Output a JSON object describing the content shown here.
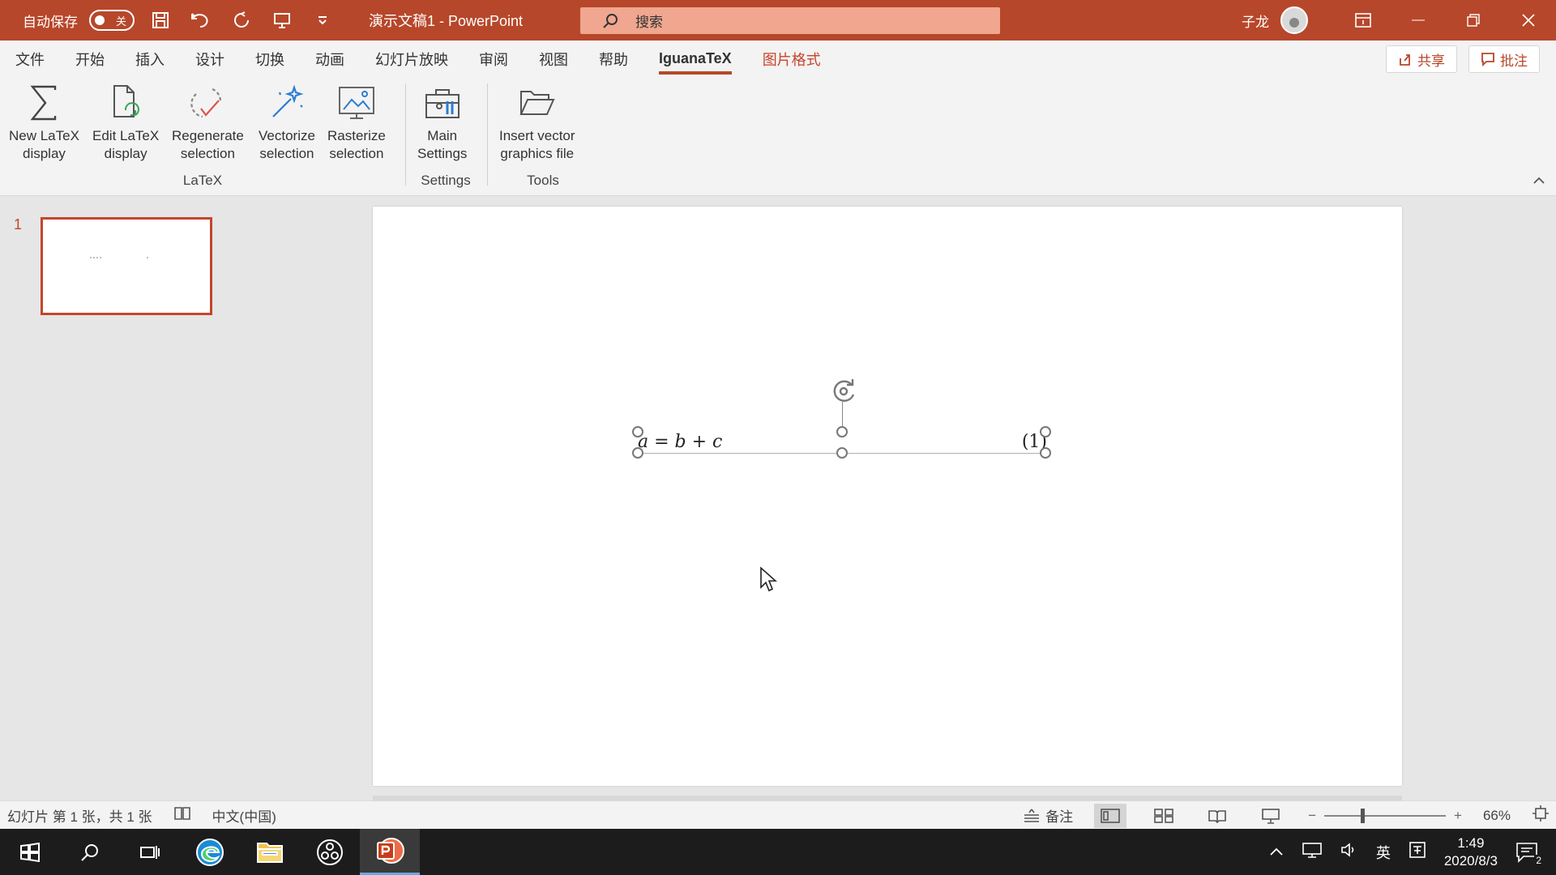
{
  "window": {
    "autosave_label": "自动保存",
    "autosave_state": "关",
    "doc_title": "演示文稿1 - PowerPoint",
    "search_placeholder": "搜索",
    "user_name": "子龙",
    "accent_color": "#b7472a"
  },
  "tabs": [
    {
      "label": "文件"
    },
    {
      "label": "开始"
    },
    {
      "label": "插入"
    },
    {
      "label": "设计"
    },
    {
      "label": "切换"
    },
    {
      "label": "动画"
    },
    {
      "label": "幻灯片放映"
    },
    {
      "label": "审阅"
    },
    {
      "label": "视图"
    },
    {
      "label": "帮助"
    },
    {
      "label": "IguanaTeX",
      "active": true
    },
    {
      "label": "图片格式",
      "contextual": true
    }
  ],
  "tab_actions": {
    "share": "共享",
    "comments": "批注"
  },
  "ribbon": {
    "groups": [
      {
        "label": "LaTeX",
        "buttons": [
          {
            "line1": "New LaTeX",
            "line2": "display",
            "icon": "sigma-icon"
          },
          {
            "line1": "Edit LaTeX",
            "line2": "display",
            "icon": "edit-document-icon"
          },
          {
            "line1": "Regenerate",
            "line2": "selection",
            "icon": "regenerate-icon"
          },
          {
            "line1": "Vectorize",
            "line2": "selection",
            "icon": "magic-wand-icon"
          },
          {
            "line1": "Rasterize",
            "line2": "selection",
            "icon": "rasterize-icon"
          }
        ]
      },
      {
        "label": "Settings",
        "buttons": [
          {
            "line1": "Main",
            "line2": "Settings",
            "icon": "toolbox-icon"
          }
        ]
      },
      {
        "label": "Tools",
        "buttons": [
          {
            "line1": "Insert vector",
            "line2": "graphics file",
            "icon": "folder-open-icon"
          }
        ]
      }
    ]
  },
  "slides": {
    "current_number": "1"
  },
  "slide": {
    "equation": "a = b + c",
    "equation_number": "(1)"
  },
  "statusbar": {
    "slide_info": "幻灯片 第 1 张，共 1 张",
    "language": "中文(中国)",
    "notes": "备注",
    "zoom": "66%"
  },
  "taskbar": {
    "ime": "英",
    "time": "1:49",
    "date": "2020/8/3",
    "notifications_count": "2"
  }
}
